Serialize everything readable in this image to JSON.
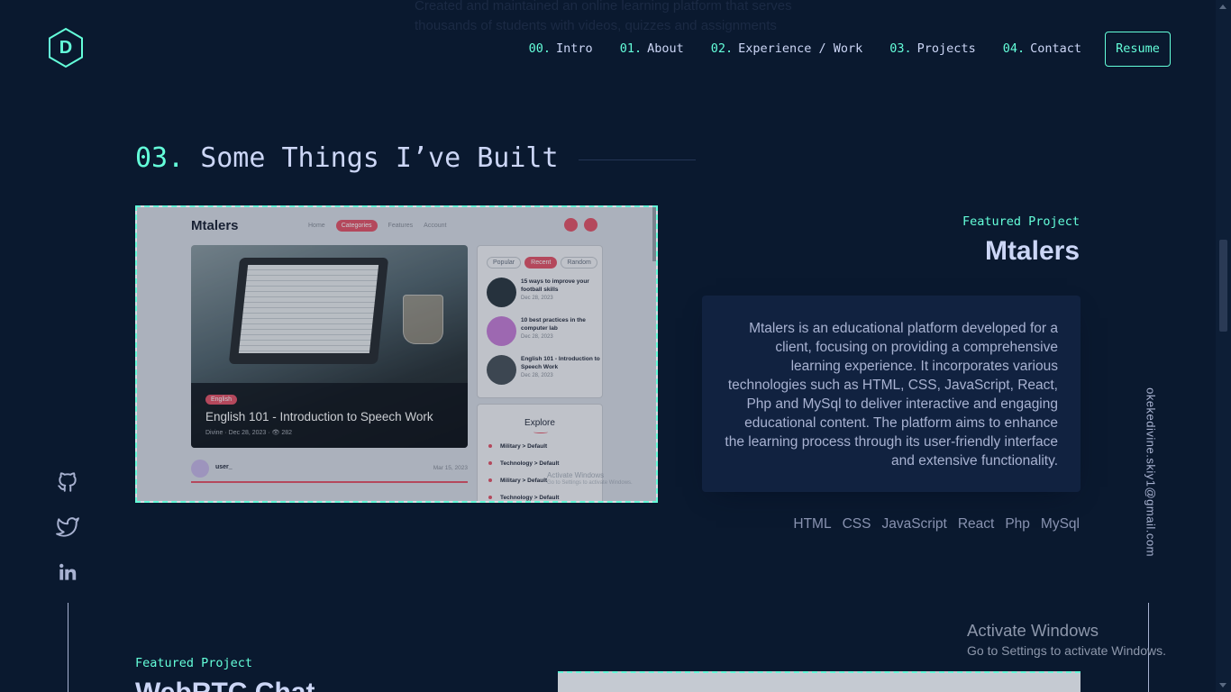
{
  "ghost_top": {
    "lines": [
      "Created and maintained an online learning platform that serves",
      "thousands of students with videos, quizzes and assignments"
    ]
  },
  "nav": {
    "logo_letter": "D",
    "links": [
      {
        "num": "00.",
        "label": "Intro"
      },
      {
        "num": "01.",
        "label": "About"
      },
      {
        "num": "02.",
        "label": "Experience / Work"
      },
      {
        "num": "03.",
        "label": "Projects"
      },
      {
        "num": "04.",
        "label": "Contact"
      }
    ],
    "resume_label": "Resume"
  },
  "section": {
    "num": "03.",
    "title": "Some Things I’ve Built"
  },
  "project1": {
    "label": "Featured Project",
    "title": "Mtalers",
    "description": "Mtalers is an educational platform developed for a client, focusing on providing a comprehensive learning experience. It incorporates various technologies such as HTML, CSS, JavaScript, React, Php and MySql to deliver interactive and engaging educational content. The platform aims to enhance the learning process through its user-friendly interface and extensive functionality.",
    "tech": [
      "HTML",
      "CSS",
      "JavaScript",
      "React",
      "Php",
      "MySql"
    ]
  },
  "screenshot": {
    "brand": "Mtalers",
    "nav": [
      "Home",
      "Categories",
      "Features",
      "Account"
    ],
    "hero_tag": "English",
    "hero_title": "English 101 - Introduction to Speech Work",
    "hero_meta": "Divine  ·  Dec 28, 2023  ·  👁 282",
    "tabs": [
      "Popular",
      "Recent",
      "Random"
    ],
    "posts": [
      {
        "title": "15 ways to improve your football skills",
        "date": "Dec 28, 2023"
      },
      {
        "title": "10 best practices in the computer lab",
        "date": "Dec 28, 2023"
      },
      {
        "title": "English 101 - Introduction to Speech Work",
        "date": "Dec 28, 2023"
      }
    ],
    "explore_title": "Explore",
    "categories": [
      "Military > Default",
      "Technology > Default",
      "Military > Default",
      "Technology > Default"
    ],
    "user_name": "user_",
    "user_date": "Mar 15, 2023",
    "watermark1": "Activate Windows",
    "watermark2": "Go to Settings to activate Windows."
  },
  "social": {
    "icons": [
      "github-icon",
      "twitter-icon",
      "linkedin-icon"
    ]
  },
  "email": "okekedivine.skiy1@gmail.com",
  "project2": {
    "label": "Featured Project",
    "title": "WebRTC Chat"
  },
  "windows": {
    "line1": "Activate Windows",
    "line2": "Go to Settings to activate Windows."
  },
  "colors": {
    "background": "#0a192f",
    "accent": "#64ffda",
    "heading": "#ccd6f6",
    "text": "#8892b0",
    "card": "#112240"
  }
}
